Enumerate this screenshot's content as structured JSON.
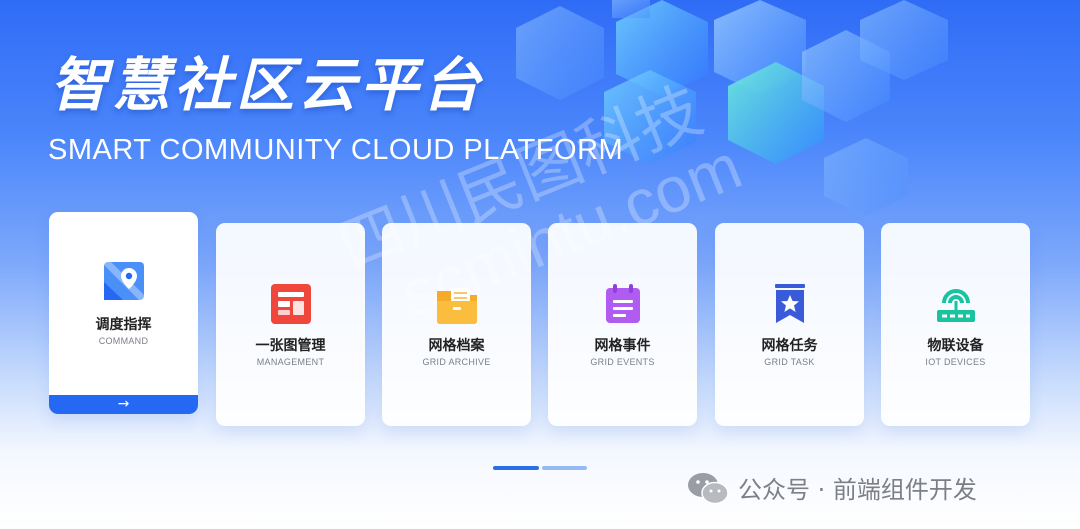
{
  "banner": {
    "title": "智慧社区云平台",
    "subtitle": "SMART COMMUNITY CLOUD PLATFORM"
  },
  "watermark": {
    "line1": "四川民图科技",
    "line2": "scmintu.com"
  },
  "cards": [
    {
      "label": "调度指挥",
      "sublabel": "COMMAND",
      "icon": "map-pin-icon",
      "active": true,
      "action_icon": "arrow-right-icon",
      "action_glyph": "→"
    },
    {
      "label": "一张图管理",
      "sublabel": "MANAGEMENT",
      "icon": "dashboard-icon",
      "active": false
    },
    {
      "label": "网格档案",
      "sublabel": "GRID ARCHIVE",
      "icon": "folder-icon",
      "active": false
    },
    {
      "label": "网格事件",
      "sublabel": "GRID EVENTS",
      "icon": "calendar-icon",
      "active": false
    },
    {
      "label": "网格任务",
      "sublabel": "GRID TASK",
      "icon": "star-badge-icon",
      "active": false
    },
    {
      "label": "物联设备",
      "sublabel": "IOT DEVICES",
      "icon": "router-icon",
      "active": false
    }
  ],
  "pagination": {
    "total": 2,
    "current": 1
  },
  "footer": {
    "text": "公众号 · 前端组件开发",
    "icon": "wechat-icon"
  },
  "colors": {
    "accent": "#2568f4",
    "dashboard": "#f0473c",
    "folder": "#f7a928",
    "calendar": "#b05cf0",
    "badge": "#3a5bd9",
    "router": "#18c3a0"
  }
}
